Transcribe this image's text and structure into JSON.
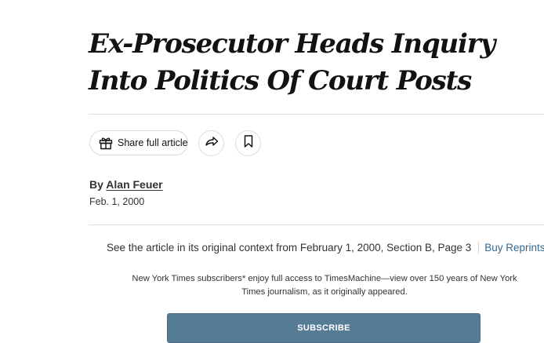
{
  "article": {
    "headline": "Ex-Prosecutor Heads Inquiry Into Politics Of Court Posts",
    "byline_prefix": "By ",
    "author": "Alan Feuer",
    "date": "Feb. 1, 2000"
  },
  "toolbar": {
    "share_label": "Share full article",
    "share_icon": "gift-icon",
    "forward_icon": "share-arrow-icon",
    "bookmark_icon": "bookmark-icon"
  },
  "timesmachine": {
    "context_text": "See the article in its original context from February 1, 2000, Section B, Page 3",
    "buy_reprints": "Buy Reprints",
    "subscriber_note": "New York Times subscribers* enjoy full access to TimesMachine—view over 150 years of New York Times journalism, as it originally appeared.",
    "subscribe_label": "SUBSCRIBE"
  },
  "colors": {
    "text": "#121212",
    "link": "#326891",
    "subscribe_button": "#567b95",
    "rule": "#dfdfdf"
  }
}
